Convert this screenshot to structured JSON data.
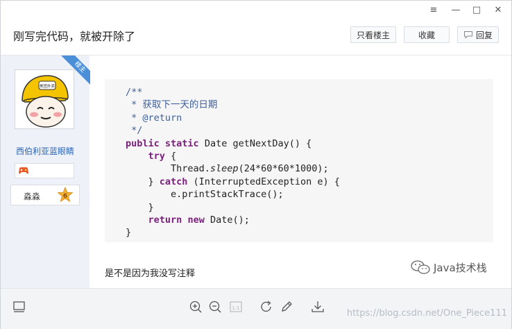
{
  "window": {
    "controls": {
      "menu": "≡",
      "minimize": "—",
      "maximize": "□",
      "close": "✕"
    }
  },
  "header": {
    "title": "刚写完代码，就被开除了",
    "buttons": {
      "only_op": "只看楼主",
      "favorite": "收藏",
      "reply": "回复"
    }
  },
  "author": {
    "badge_label": "楼主",
    "name": "西伯利亚蓝眼睛",
    "level_name": "淼淼",
    "level": "6",
    "avatar_text": "美团外卖"
  },
  "post": {
    "code_lines": [
      "/**",
      " * 获取下一天的日期",
      " * @return",
      " */",
      "public static Date getNextDay() {",
      "    try {",
      "        Thread.sleep(24*60*60*1000);",
      "    } catch (InterruptedException e) {",
      "        e.printStackTrace();",
      "    }",
      "    return new Date();",
      "}"
    ],
    "text": "是不是因为我没写注释",
    "overlay_label": "Java技术栈"
  },
  "footer": {
    "watermark": "https://blog.csdn.net/One_Piece111"
  },
  "colors": {
    "accent": "#4a8fd8",
    "sidebar_bg": "#eef2f8",
    "username": "#2d64b3",
    "code_bg": "#f6f6f6",
    "keyword": "#7a1f7a",
    "comment": "#3e5f99"
  }
}
